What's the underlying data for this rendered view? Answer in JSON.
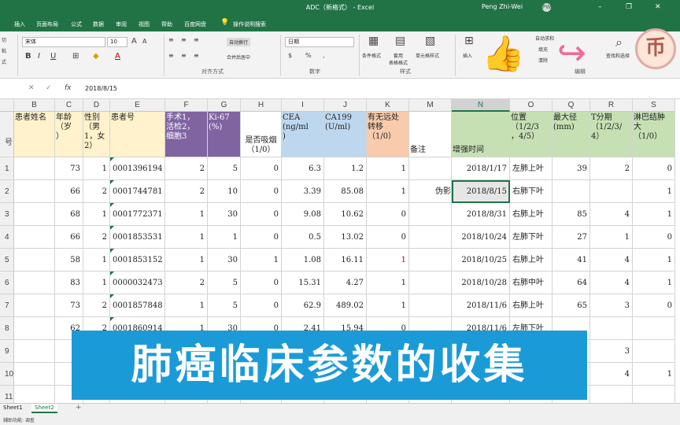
{
  "window": {
    "title": "ADC（新格式） - Excel",
    "user": "Peng Zhi-Wei",
    "avatar": "PW",
    "minimize": "–",
    "restore": "❐",
    "close": "✕"
  },
  "tabs": [
    "插入",
    "页面布局",
    "公式",
    "数据",
    "审阅",
    "视图",
    "帮助",
    "百度网盘",
    "操作说明搜索"
  ],
  "ribbon": {
    "paste": "切",
    "copy": "粘",
    "fmt": "式",
    "font": "宋体",
    "size": "10",
    "grow": "A",
    "shrink": "A",
    "bold": "B",
    "italic": "I",
    "underline": "U",
    "wrap": "自动换行",
    "merge": "合并后居中",
    "numfmt": "日期",
    "cond": "条件格式",
    "table": "套用\n表格格式",
    "style": "单元格样式",
    "insert": "插入",
    "autosum": "自动求和",
    "fill": "填充",
    "clear": "清除",
    "find": "查找和选择",
    "g_align": "对齐方式",
    "g_num": "数字",
    "g_style": "样式",
    "g_cell": "单元格",
    "g_edit": "编辑"
  },
  "formula_bar": {
    "value": "2018/8/15",
    "cancel": "✕",
    "enter": "✓",
    "fx": "fx"
  },
  "columns": [
    "B",
    "C",
    "D",
    "E",
    "F",
    "G",
    "H",
    "I",
    "J",
    "K",
    "M",
    "N",
    "O",
    "Q",
    "R",
    "S"
  ],
  "headers": {
    "A": "号",
    "B": "患者姓名",
    "C": "年龄\n（岁\n）",
    "D": "性别\n（男\n1，女\n2）",
    "E": "患者号",
    "F": "手术1，\n活检2，\n细胞3",
    "G": "Ki-67\n(%)",
    "H": "是否吸烟\n（1/0）",
    "I": "CEA\n(ng/ml\n)",
    "J": "CA199\n(U/ml)",
    "K": "有无远处\n转移\n（1/0）",
    "M": "备注",
    "N": "增强时间",
    "O": "位置\n（1/2/3\n，4/5）",
    "Q": "最大径\n(mm)",
    "R": "T分期\n（1/2/3/\n4）",
    "S": "淋巴结肿\n大\n（1/0）"
  },
  "rows": [
    {
      "n": "1",
      "C": "73",
      "D": "1",
      "E": "0001396194",
      "F": "2",
      "G": "5",
      "H": "0",
      "I": "6.3",
      "J": "1.2",
      "K": "1",
      "M": "",
      "N": "2018/1/17",
      "O": "左肺上叶",
      "Q": "39",
      "R": "2",
      "S": "0"
    },
    {
      "n": "2",
      "C": "66",
      "D": "2",
      "E": "0001744781",
      "F": "2",
      "G": "10",
      "H": "0",
      "I": "3.39",
      "J": "85.08",
      "K": "1",
      "M": "伪影",
      "N": "2018/8/15",
      "O": "右肺下叶",
      "Q": "",
      "R": "",
      "S": "1"
    },
    {
      "n": "3",
      "C": "68",
      "D": "1",
      "E": "0001772371",
      "F": "1",
      "G": "30",
      "H": "0",
      "I": "9.08",
      "J": "10.62",
      "K": "0",
      "M": "",
      "N": "2018/8/31",
      "O": "右肺上叶",
      "Q": "85",
      "R": "4",
      "S": "1"
    },
    {
      "n": "4",
      "C": "66",
      "D": "2",
      "E": "0001853531",
      "F": "1",
      "G": "1",
      "H": "0",
      "I": "0.5",
      "J": "13.02",
      "K": "0",
      "M": "",
      "N": "2018/10/24",
      "O": "左肺下叶",
      "Q": "27",
      "R": "1",
      "S": "0"
    },
    {
      "n": "5",
      "C": "58",
      "D": "1",
      "E": "0001853152",
      "F": "1",
      "G": "30",
      "H": "1",
      "I": "1.08",
      "J": "16.11",
      "K": "1",
      "M": "",
      "N": "2018/10/25",
      "O": "右肺上叶",
      "Q": "41",
      "R": "4",
      "S": "1"
    },
    {
      "n": "6",
      "C": "83",
      "D": "1",
      "E": "0000032473",
      "F": "2",
      "G": "5",
      "H": "0",
      "I": "15.31",
      "J": "4.27",
      "K": "1",
      "M": "",
      "N": "2018/10/28",
      "O": "右肺中叶",
      "Q": "64",
      "R": "4",
      "S": "1"
    },
    {
      "n": "7",
      "C": "73",
      "D": "2",
      "E": "0001857848",
      "F": "1",
      "G": "5",
      "H": "0",
      "I": "62.9",
      "J": "489.02",
      "K": "1",
      "M": "",
      "N": "2018/11/6",
      "O": "右肺上叶",
      "Q": "65",
      "R": "3",
      "S": "0"
    },
    {
      "n": "8",
      "C": "62",
      "D": "2",
      "E": "0001860914",
      "F": "1",
      "G": "30",
      "H": "0",
      "I": "2.41",
      "J": "15.94",
      "K": "0",
      "M": "",
      "N": "2018/11/6",
      "O": "左肺下叶",
      "Q": "",
      "R": "",
      "S": ""
    },
    {
      "n": "9",
      "C": "",
      "D": "",
      "E": "",
      "F": "",
      "G": "",
      "H": "",
      "I": "",
      "J": "",
      "K": "",
      "M": "",
      "N": "",
      "O": "",
      "Q": "",
      "R": "3",
      "S": ""
    },
    {
      "n": "10",
      "C": "",
      "D": "",
      "E": "",
      "F": "",
      "G": "",
      "H": "",
      "I": "",
      "J": "",
      "K": "",
      "M": "",
      "N": "",
      "O": "",
      "Q": "",
      "R": "4",
      "S": "1"
    },
    {
      "n": "11",
      "C": "",
      "D": "",
      "E": "",
      "F": "",
      "G": "",
      "H": "",
      "I": "",
      "J": "",
      "K": "",
      "M": "",
      "N": "",
      "O": "",
      "Q": "",
      "R": "",
      "S": ""
    }
  ],
  "colors": {
    "excel_green": "#217346",
    "purple": "#8064a2",
    "blue": "#bdd7ee",
    "orange": "#f8cbad",
    "green": "#c6e0b4",
    "yellow": "#fff2cc",
    "banner": "#1a9bd8",
    "red_value": "#c00000"
  },
  "banner": "肺癌临床参数的收集",
  "sheets": [
    "Sheet1",
    "Sheet2"
  ],
  "add_sheet": "+",
  "status": "辅助功能: 调查",
  "logo": "币"
}
